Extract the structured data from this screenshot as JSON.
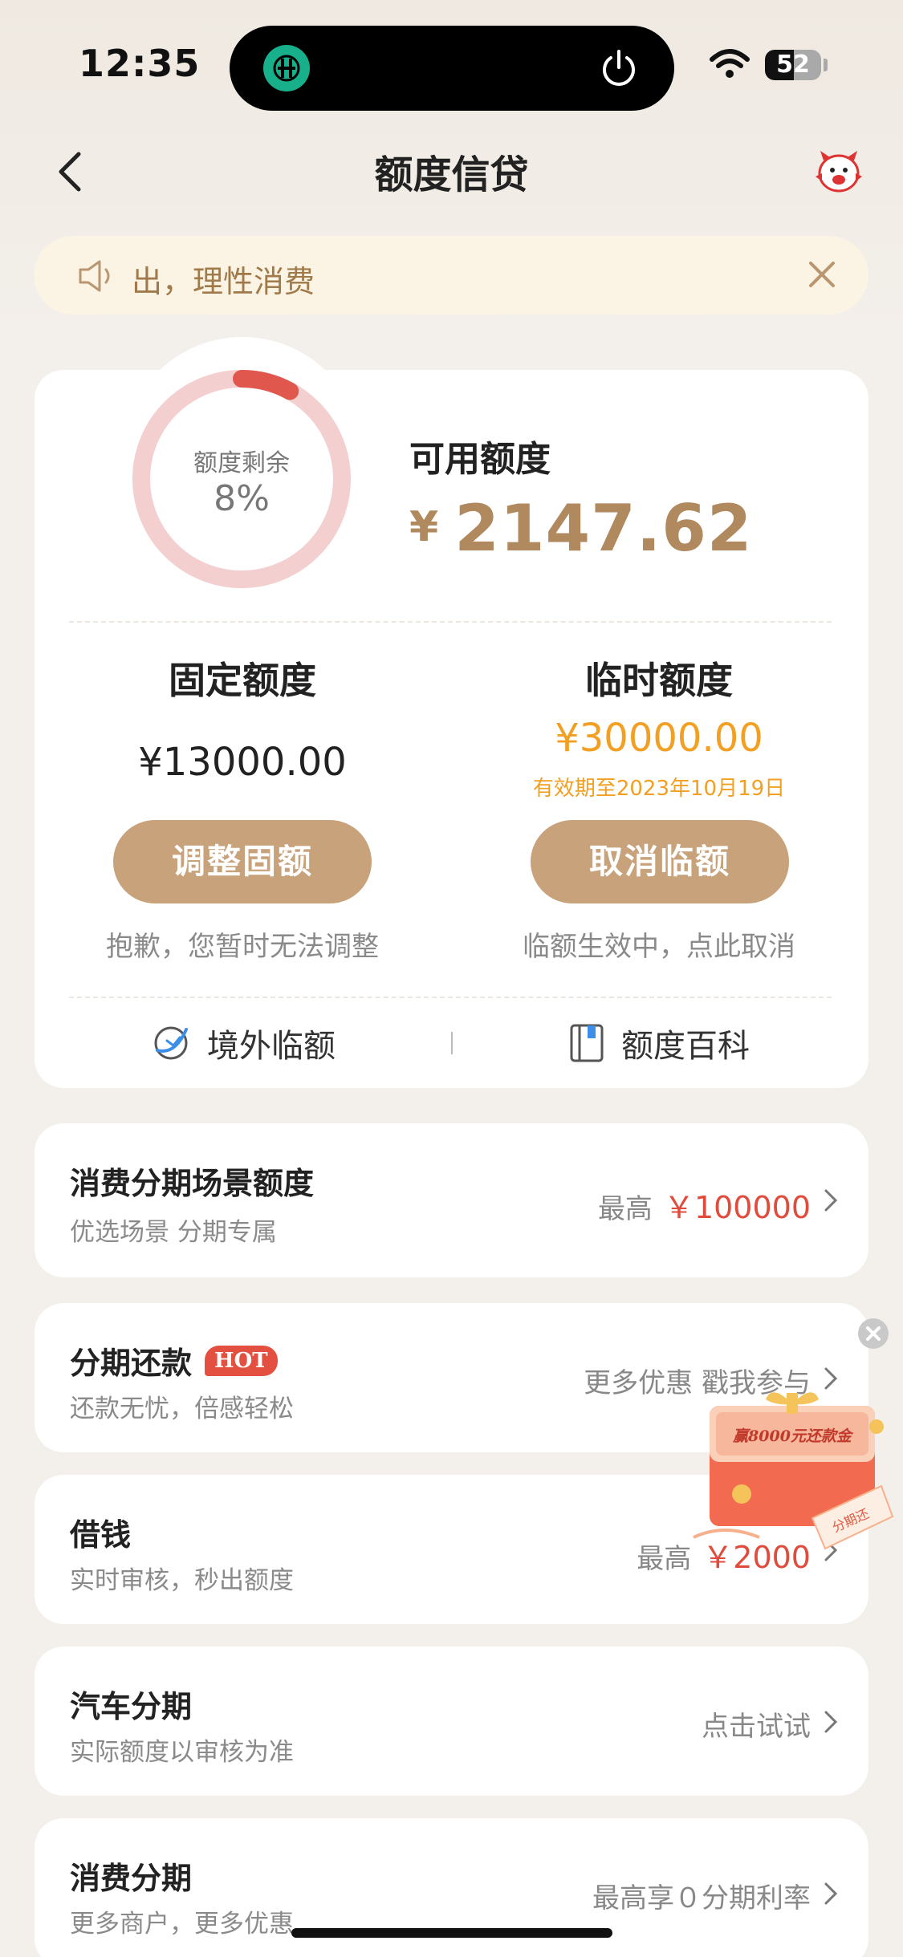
{
  "status_bar": {
    "time": "12:35",
    "battery": "52"
  },
  "nav": {
    "title": "额度信贷"
  },
  "notice": {
    "text": "出，理性消费"
  },
  "summary": {
    "ring_label": "额度剩余",
    "ring_percent": "8%",
    "remaining_fraction": 0.08,
    "available_label": "可用额度",
    "currency": "¥",
    "available_amount": "2147.62"
  },
  "fixed": {
    "title": "固定额度",
    "amount": "¥13000.00",
    "button": "调整固额",
    "hint": "抱歉，您暂时无法调整"
  },
  "temporary": {
    "title": "临时额度",
    "amount": "¥30000.00",
    "valid_until": "有效期至2023年10月19日",
    "button": "取消临额",
    "hint": "临额生效中，点此取消"
  },
  "links": {
    "overseas": "境外临额",
    "encyclopedia": "额度百科"
  },
  "items": [
    {
      "title": "消费分期场景额度",
      "subtitle": "优选场景 分期专属",
      "right_prefix": "最高",
      "right_value": "￥100000"
    },
    {
      "title": "分期还款",
      "badge": "HOT",
      "subtitle": "还款无忧，倍感轻松",
      "right_text": "更多优惠 戳我参与"
    },
    {
      "title": "借钱",
      "subtitle": "实时审核，秒出额度",
      "right_prefix": "最高",
      "right_value": "￥2000"
    },
    {
      "title": "汽车分期",
      "subtitle": "实际额度以审核为准",
      "right_text": "点击试试"
    },
    {
      "title": "消费分期",
      "subtitle": "更多商户，更多优惠",
      "right_text": "最高享０分期利率"
    }
  ],
  "promo": {
    "text": "赢8000元还款金",
    "stamp": "分期还"
  },
  "colors": {
    "gold": "#c8a27a",
    "amount_gold": "#b08a5e",
    "orange": "#f2a024",
    "red": "#e04b3c",
    "ring_track": "#f4cfcf",
    "ring_arc": "#e0574e"
  }
}
